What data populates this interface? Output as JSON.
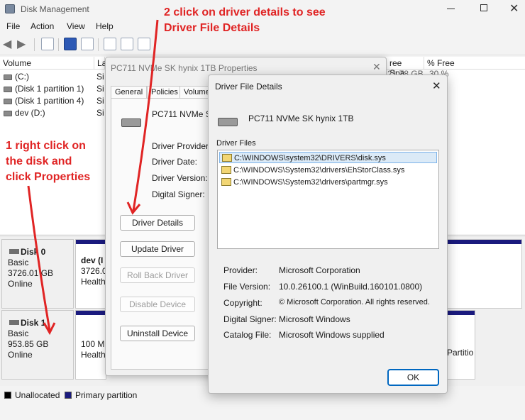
{
  "window": {
    "title": "Disk Management"
  },
  "menu": [
    "File",
    "Action",
    "View",
    "Help"
  ],
  "volume_columns": [
    "Volume",
    "La",
    "ree Spa...",
    "% Free"
  ],
  "volumes": [
    {
      "name": "(C:)",
      "type": "Si",
      "free": "21.78 GB",
      "pct": "30 %"
    },
    {
      "name": "(Disk 1 partition 1)",
      "type": "Si"
    },
    {
      "name": "(Disk 1 partition 4)",
      "type": "Si"
    },
    {
      "name": "dev (D:)",
      "type": "Si"
    }
  ],
  "disks": [
    {
      "name": "Disk 0",
      "type": "Basic",
      "size": "3726.01 GB",
      "status": "Online",
      "partition_title": "dev (I",
      "partition_size": "3726.0",
      "partition_health": "Health"
    },
    {
      "name": "Disk 1",
      "type": "Basic",
      "size": "953.85 GB",
      "status": "Online",
      "partition_size": "100 M",
      "partition_health": "Health",
      "partition_right": "Partitio"
    }
  ],
  "legend": {
    "unallocated": "Unallocated",
    "primary": "Primary partition"
  },
  "properties": {
    "title": "PC711 NVMe SK hynix 1TB Properties",
    "tabs": [
      "General",
      "Policies",
      "Volumes"
    ],
    "device_name": "PC711 NVMe SK",
    "fields": [
      "Driver Provider:",
      "Driver Date:",
      "Driver Version:",
      "Digital Signer:"
    ],
    "buttons": {
      "driver_details": "Driver Details",
      "update_driver": "Update Driver",
      "roll_back": "Roll Back Driver",
      "disable": "Disable Device",
      "uninstall": "Uninstall Device"
    }
  },
  "driver_file_details": {
    "title": "Driver File Details",
    "device_name": "PC711 NVMe SK hynix 1TB",
    "files_label": "Driver Files",
    "files": [
      "C:\\WINDOWS\\system32\\DRIVERS\\disk.sys",
      "C:\\WINDOWS\\System32\\drivers\\EhStorClass.sys",
      "C:\\WINDOWS\\System32\\drivers\\partmgr.sys"
    ],
    "info": [
      {
        "label": "Provider:",
        "value": "Microsoft Corporation"
      },
      {
        "label": "File Version:",
        "value": "10.0.26100.1 (WinBuild.160101.0800)"
      },
      {
        "label": "Copyright:",
        "value": "© Microsoft Corporation. All rights reserved."
      },
      {
        "label": "Digital Signer:",
        "value": "Microsoft Windows"
      },
      {
        "label": "Catalog File:",
        "value": "Microsoft Windows supplied"
      }
    ],
    "ok": "OK"
  },
  "annotations": {
    "step2_line1": "2 click on driver details to see",
    "step2_line2": "Driver File Details",
    "step1_line1": "1 right click on",
    "step1_line2": "the disk and",
    "step1_line3": "click Properties"
  },
  "colors": {
    "annotation": "#e02424",
    "primary_partition": "#1a1a7e",
    "selection": "#dbeaf7",
    "ok_border": "#0067c0"
  }
}
